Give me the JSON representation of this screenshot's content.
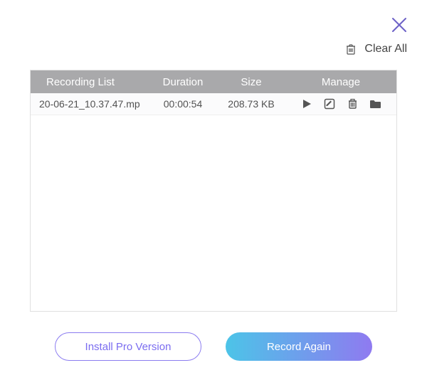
{
  "header": {
    "clear_all_label": "Clear All"
  },
  "table": {
    "columns": {
      "recording_list": "Recording List",
      "duration": "Duration",
      "size": "Size",
      "manage": "Manage"
    },
    "rows": [
      {
        "name": "20-06-21_10.37.47.mp",
        "duration": "00:00:54",
        "size": "208.73 KB"
      }
    ]
  },
  "buttons": {
    "install_pro": "Install Pro Version",
    "record_again": "Record Again"
  }
}
